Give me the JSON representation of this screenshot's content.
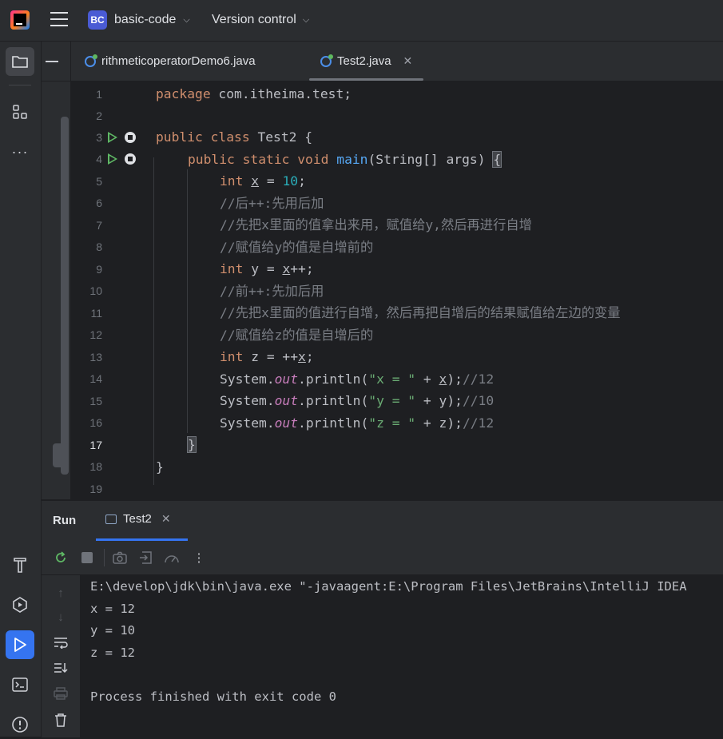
{
  "header": {
    "project_badge": "BC",
    "project_name": "basic-code",
    "vcs_label": "Version control"
  },
  "editor": {
    "tabs": [
      {
        "label": "rithmeticoperatorDemo6.java"
      },
      {
        "label": "Test2.java"
      }
    ],
    "line_numbers": [
      "1",
      "2",
      "3",
      "4",
      "5",
      "6",
      "7",
      "8",
      "9",
      "10",
      "11",
      "12",
      "13",
      "14",
      "15",
      "16",
      "17",
      "18",
      "19"
    ],
    "code": {
      "l1_kw": "package",
      "l1_rest": " com.itheima.test;",
      "l3_kw": "public class",
      "l3_rest": " Test2 {",
      "l4_kw": "public static void",
      "l4_fn": "main",
      "l4_rest": "(String[] args) ",
      "l4_brace": "{",
      "l5_kw": "int",
      "l5_var": "x",
      "l5_eq": " = ",
      "l5_num": "10",
      "l5_end": ";",
      "l6": "//后++:先用后加",
      "l7": "//先把x里面的值拿出来用，赋值给y,然后再进行自增",
      "l8": "//赋值给y的值是自增前的",
      "l9_kw": "int",
      "l9_a": " y = ",
      "l9_var": "x",
      "l9_b": "++;",
      "l10": "//前++:先加后用",
      "l11": "//先把x里面的值进行自增，然后再把自增后的结果赋值给左边的变量",
      "l12": "//赋值给z的值是自增后的",
      "l13_kw": "int",
      "l13_a": " z = ++",
      "l13_var": "x",
      "l13_b": ";",
      "l14_a": "System.",
      "l14_out": "out",
      "l14_b": ".println(",
      "l14_str": "\"x = \"",
      "l14_c": " + ",
      "l14_var": "x",
      "l14_d": ");",
      "l14_cm": "//12",
      "l15_a": "System.",
      "l15_out": "out",
      "l15_b": ".println(",
      "l15_str": "\"y = \"",
      "l15_c": " + y);",
      "l15_cm": "//10",
      "l16_a": "System.",
      "l16_out": "out",
      "l16_b": ".println(",
      "l16_str": "\"z = \"",
      "l16_c": " + z);",
      "l16_cm": "//12",
      "l17": "}",
      "l18": "}"
    }
  },
  "run_panel": {
    "title": "Run",
    "tab_label": "Test2",
    "console_lines": [
      "E:\\develop\\jdk\\bin\\java.exe \"-javaagent:E:\\Program Files\\JetBrains\\IntelliJ IDEA",
      "x = 12",
      "y = 10",
      "z = 12",
      "",
      "Process finished with exit code 0"
    ]
  },
  "icons": [
    "project-folder-icon",
    "structure-icon",
    "more-icon",
    "build-hammer-icon",
    "services-icon",
    "run-icon",
    "terminal-icon",
    "problems-icon"
  ]
}
